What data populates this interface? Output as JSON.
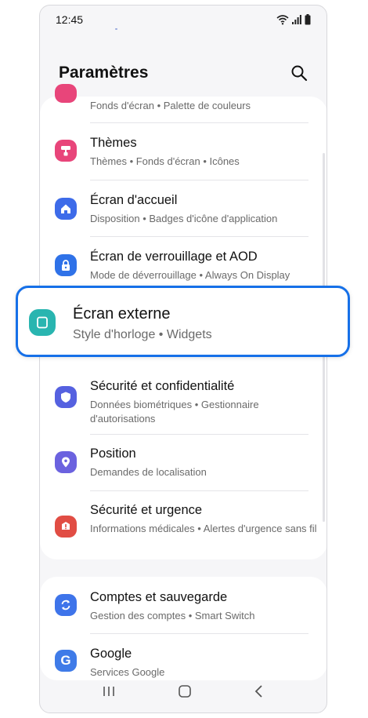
{
  "status_bar": {
    "time": "12:45"
  },
  "header": {
    "title": "Paramètres"
  },
  "card1": {
    "partial": {
      "subtitle": "Fonds d'écran  •  Palette de couleurs"
    },
    "items": [
      {
        "title": "Thèmes",
        "subtitle": "Thèmes  •  Fonds d'écran  •  Icônes",
        "color": "#e8457a"
      },
      {
        "title": "Écran d'accueil",
        "subtitle": "Disposition  •  Badges d'icône d'application",
        "color": "#3d6be9"
      },
      {
        "title": "Écran de verrouillage et AOD",
        "subtitle": "Mode de déverrouillage  •  Always On Display",
        "color": "#2f72e8"
      },
      {
        "title": "Sécurité et confidentialité",
        "subtitle": "Données biométriques  •  Gestionnaire d'autorisations",
        "color": "#5561e0"
      },
      {
        "title": "Position",
        "subtitle": "Demandes de localisation",
        "color": "#6b62df"
      },
      {
        "title": "Sécurité et urgence",
        "subtitle": "Informations médicales  •  Alertes d'urgence sans fil",
        "color": "#e14d44"
      }
    ]
  },
  "highlight": {
    "title": "Écran externe",
    "subtitle": "Style d'horloge  •  Widgets",
    "color": "#29b5b0",
    "border_color": "#1670e8"
  },
  "card2": {
    "items": [
      {
        "title": "Comptes et sauvegarde",
        "subtitle": "Gestion des comptes  •  Smart Switch",
        "color": "#3e74ea"
      },
      {
        "title": "Google",
        "subtitle": "Services Google",
        "color": "#3f7be8"
      }
    ]
  },
  "icons": {
    "themes": "brush-icon",
    "home": "home-icon",
    "lock": "lock-icon",
    "external": "external-screen-icon",
    "security": "shield-icon",
    "position": "location-pin-icon",
    "emergency": "alert-icon",
    "accounts": "sync-icon",
    "google": "google-icon"
  }
}
